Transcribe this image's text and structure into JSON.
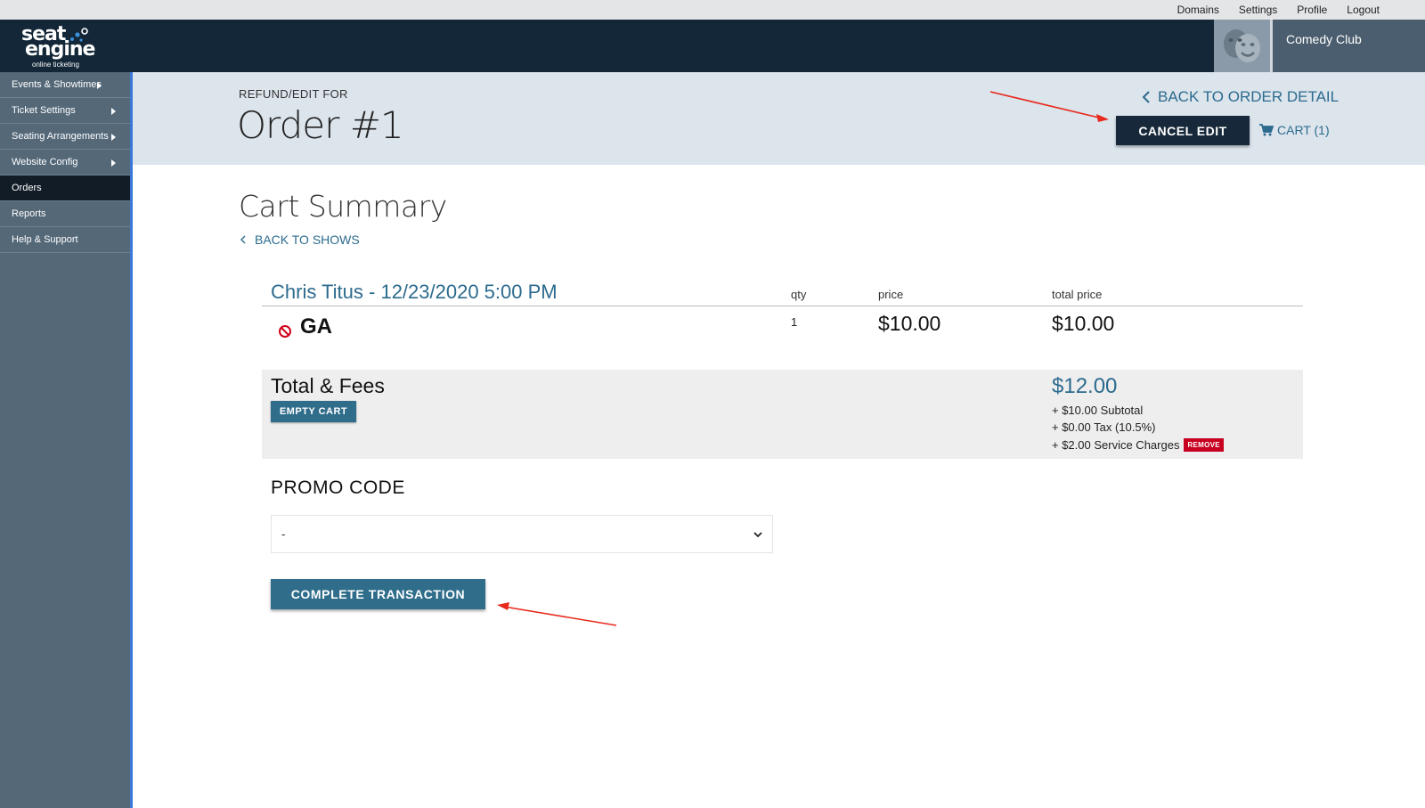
{
  "topbar": {
    "links": [
      "Domains",
      "Settings",
      "Profile",
      "Logout"
    ]
  },
  "brand": {
    "line1": "seat",
    "line2": "engine",
    "tagline": "online ticketing"
  },
  "venue": {
    "name": "Comedy Club"
  },
  "sidebar": {
    "items": [
      {
        "label": "Events & Showtimes",
        "has_arrow": true
      },
      {
        "label": "Ticket Settings",
        "has_arrow": true
      },
      {
        "label": "Seating Arrangements",
        "has_arrow": true
      },
      {
        "label": "Website Config",
        "has_arrow": true
      },
      {
        "label": "Orders",
        "active": true
      },
      {
        "label": "Reports"
      },
      {
        "label": "Help & Support"
      }
    ]
  },
  "header": {
    "refund_label": "REFUND/EDIT FOR",
    "order_title": "Order #1",
    "back_to_order": "BACK TO ORDER DETAIL",
    "cancel_edit": "CANCEL EDIT",
    "cart": "CART (1)"
  },
  "cart": {
    "title": "Cart Summary",
    "back_to_shows": "BACK TO SHOWS",
    "show_name": "Chris Titus - 12/23/2020 5:00 PM",
    "columns": {
      "qty": "qty",
      "price": "price",
      "total": "total price"
    },
    "items": [
      {
        "type": "GA",
        "qty": "1",
        "price": "$10.00",
        "total": "$10.00"
      }
    ],
    "fees": {
      "title": "Total & Fees",
      "empty_cart": "EMPTY CART",
      "grand_total": "$12.00",
      "subtotal": "+ $10.00 Subtotal",
      "tax": "+ $0.00 Tax (10.5%)",
      "service": "+ $2.00 Service Charges",
      "remove": "REMOVE"
    },
    "promo": {
      "title": "PROMO CODE",
      "selected": "-"
    },
    "complete": "COMPLETE TRANSACTION"
  },
  "colors": {
    "header": "#132738",
    "sidebar": "#546878",
    "accent": "#2c6b8e",
    "annotation": "#e8291c"
  }
}
